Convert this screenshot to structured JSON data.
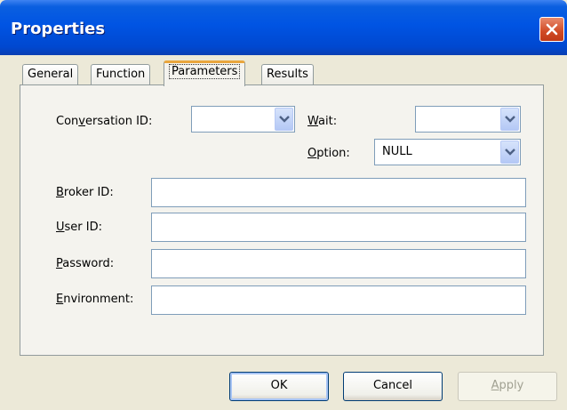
{
  "window": {
    "title": "Properties"
  },
  "tabs": [
    {
      "label": "General",
      "active": false
    },
    {
      "label": "Function",
      "active": false
    },
    {
      "label": "Parameters",
      "active": true
    },
    {
      "label": "Results",
      "active": false
    }
  ],
  "parameters": {
    "conversation_id": {
      "pre": "Con",
      "key": "v",
      "post": "ersation ID:",
      "value": ""
    },
    "wait": {
      "pre": "",
      "key": "W",
      "post": "ait:",
      "value": ""
    },
    "option": {
      "pre": "",
      "key": "O",
      "post": "ption:",
      "value": "NULL"
    },
    "broker_id": {
      "pre": "",
      "key": "B",
      "post": "roker ID:",
      "value": ""
    },
    "user_id": {
      "pre": "",
      "key": "U",
      "post": "ser ID:",
      "value": ""
    },
    "password": {
      "pre": "",
      "key": "P",
      "post": "assword:",
      "value": ""
    },
    "environment": {
      "pre": "",
      "key": "E",
      "post": "nvironment:",
      "value": ""
    }
  },
  "buttons": {
    "ok": "OK",
    "cancel": "Cancel",
    "apply": {
      "key": "A",
      "post": "pply",
      "enabled": false
    }
  },
  "colors": {
    "titlebar": "#0054e3",
    "dialog_bg": "#ece9d8",
    "active_tab_accent": "#e9a63d",
    "close_button": "#d04a24"
  },
  "icons": {
    "close": "close-icon",
    "dropdown": "chevron-down-icon"
  }
}
